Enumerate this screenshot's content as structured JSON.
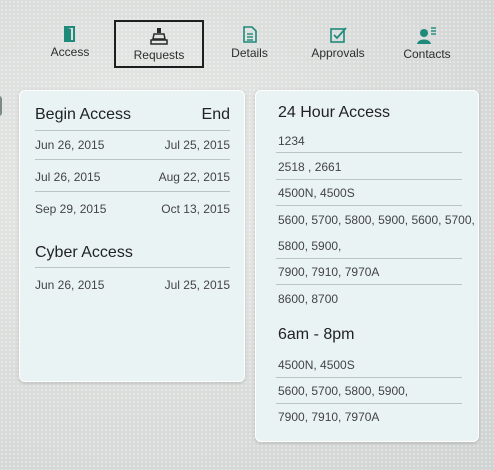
{
  "tabs": [
    {
      "label": "Access",
      "icon": "door-icon",
      "active": false
    },
    {
      "label": "Requests",
      "icon": "clipboard-stamp-icon",
      "active": true
    },
    {
      "label": "Details",
      "icon": "document-icon",
      "active": false
    },
    {
      "label": "Approvals",
      "icon": "checkbox-icon",
      "active": false
    },
    {
      "label": "Contacts",
      "icon": "contact-person-icon",
      "active": false
    }
  ],
  "accent_color": "#1f8a7a",
  "left_card": {
    "begin_header": "Begin Access",
    "end_header": "End",
    "access_rows": [
      {
        "begin": "Jun 26, 2015",
        "end": "Jul 25, 2015"
      },
      {
        "begin": "Jul 26, 2015",
        "end": "Aug 22, 2015"
      },
      {
        "begin": "Sep 29, 2015",
        "end": "Oct 13, 2015"
      }
    ],
    "cyber_header": "Cyber Access",
    "cyber_rows": [
      {
        "begin": "Jun 26, 2015",
        "end": "Jul 25, 2015"
      }
    ]
  },
  "right_card": {
    "hour24_header": "24 Hour Access",
    "hour24_lines": [
      "1234",
      "2518 , 2661",
      "4500N, 4500S",
      "5600, 5700, 5800, 5900, 5600, 5700,",
      "5800, 5900,",
      "7900, 7910, 7970A",
      "8600, 8700"
    ],
    "day_header": "6am - 8pm",
    "day_lines": [
      "4500N, 4500S",
      "5600, 5700, 5800, 5900,",
      "7900, 7910, 7970A"
    ]
  }
}
